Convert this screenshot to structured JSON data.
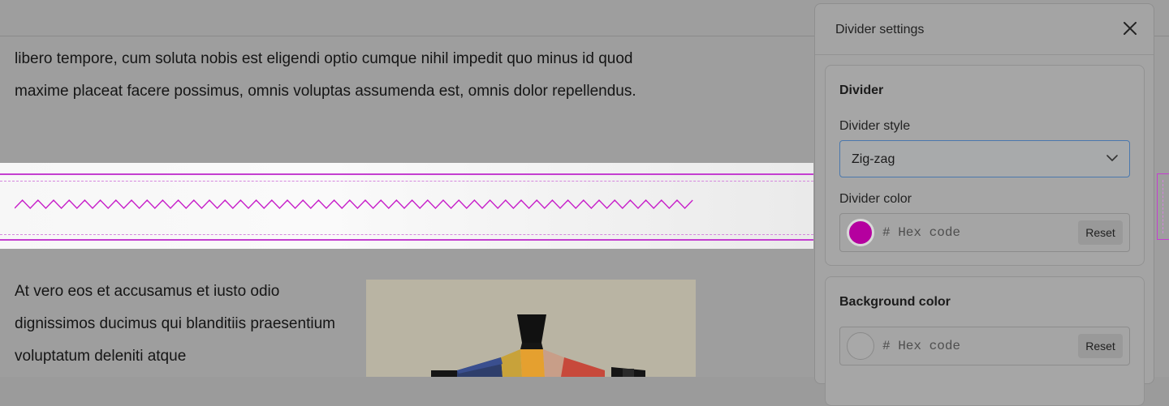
{
  "editor": {
    "paragraph_top": "libero tempore, cum soluta nobis est eligendi optio cumque nihil impedit quo minus id quod maxime placeat facere possimus, omnis voluptas assumenda est, omnis dolor repellendus.",
    "paragraph_bottom": "At vero eos et accusamus et iusto odio dignissimos ducimus qui blanditiis praesentium voluptatum deleniti atque",
    "divider_preview_color": "#c71ec9",
    "selection_color": "#c43fd0"
  },
  "panel": {
    "title": "Divider settings",
    "close_icon": "close-icon",
    "divider_section": {
      "title": "Divider",
      "style_label": "Divider style",
      "style_value": "Zig-zag",
      "color_label": "Divider color",
      "color_swatch": "#b5009f",
      "hex_placeholder": "# Hex code",
      "hex_value": "",
      "reset_label": "Reset"
    },
    "background_section": {
      "title": "Background color",
      "hex_placeholder": "# Hex code",
      "hex_value": "",
      "reset_label": "Reset"
    }
  }
}
